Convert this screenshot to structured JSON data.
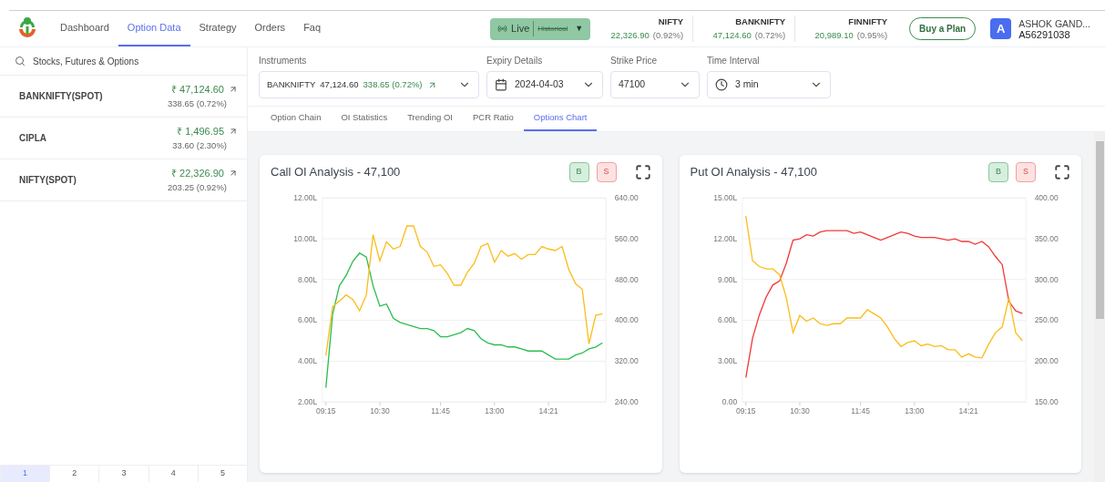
{
  "nav": {
    "items": [
      {
        "label": "Dashboard",
        "selected": false
      },
      {
        "label": "Option Data",
        "selected": true
      },
      {
        "label": "Strategy",
        "selected": false
      },
      {
        "label": "Orders",
        "selected": false
      },
      {
        "label": "Faq",
        "selected": false
      }
    ]
  },
  "mode_toggle": {
    "options": [
      {
        "label": "Live",
        "selected": true
      },
      {
        "label": "Historical",
        "selected": false
      }
    ],
    "caret": "▼"
  },
  "tickers": [
    {
      "name": "NIFTY",
      "price": "22,326.90",
      "change": "(0.92%)"
    },
    {
      "name": "BANKNIFTY",
      "price": "47,124.60",
      "change": "(0.72%)"
    },
    {
      "name": "FINNIFTY",
      "price": "20,989.10",
      "change": "(0.95%)"
    }
  ],
  "buy_button": "Buy a Plan",
  "user": {
    "initial": "A",
    "name": "ASHOK GAND...",
    "id": "A56291038"
  },
  "sidebar": {
    "search": {
      "placeholder": "Stocks, Futures & Options"
    },
    "items": [
      {
        "name": "BANKNIFTY(SPOT)",
        "price": "₹ 47,124.60",
        "change": "338.65 (0.72%)"
      },
      {
        "name": "CIPLA",
        "price": "₹ 1,496.95",
        "change": "33.60 (2.30%)"
      },
      {
        "name": "NIFTY(SPOT)",
        "price": "₹ 22,326.90",
        "change": "203.25 (0.92%)"
      }
    ],
    "pages": [
      {
        "label": "1",
        "selected": true
      },
      {
        "label": "2",
        "selected": false
      },
      {
        "label": "3",
        "selected": false
      },
      {
        "label": "4",
        "selected": false
      },
      {
        "label": "5",
        "selected": false
      }
    ]
  },
  "filters": [
    {
      "kind": "instrument",
      "label": "Instruments",
      "symbol": "BANKNIFTY",
      "price": "47,124.60",
      "change": "338.65 (0.72%)"
    },
    {
      "kind": "date",
      "label": "Expiry Details",
      "value": "2024-04-03"
    },
    {
      "kind": "plain",
      "label": "Strike Price",
      "value": "47100"
    },
    {
      "kind": "time",
      "label": "Time Interval",
      "value": "3 min"
    }
  ],
  "tabs": [
    {
      "label": "Option Chain",
      "selected": false
    },
    {
      "label": "OI Statistics",
      "selected": false
    },
    {
      "label": "Trending OI",
      "selected": false
    },
    {
      "label": "PCR Ratio",
      "selected": false
    },
    {
      "label": "Options Chart",
      "selected": true
    }
  ],
  "charts": [
    {
      "buy": "B",
      "sell": "S",
      "chart_data": {
        "type": "line",
        "title": "Call OI Analysis - 47,100",
        "grid": true,
        "categories": [
          "09:15",
          null,
          null,
          null,
          null,
          null,
          null,
          null,
          "10:30",
          null,
          null,
          null,
          null,
          null,
          null,
          null,
          null,
          "11:45",
          null,
          null,
          null,
          null,
          null,
          null,
          null,
          "13:00",
          null,
          null,
          null,
          null,
          null,
          null,
          null,
          "14:21",
          null,
          null,
          null,
          null,
          null,
          null,
          null,
          null
        ],
        "ylim": [
          2,
          12
        ],
        "yticks": [
          {
            "value": 2,
            "label": "2.00L"
          },
          {
            "value": 4,
            "label": "4.00L"
          },
          {
            "value": 6,
            "label": "6.00L"
          },
          {
            "value": 8,
            "label": "8.00L"
          },
          {
            "value": 10,
            "label": "10.00L"
          },
          {
            "value": 12,
            "label": "12.00L"
          }
        ],
        "y2lim": [
          240,
          640
        ],
        "y2ticks": [
          {
            "value": 240,
            "label": "240.00"
          },
          {
            "value": 320,
            "label": "320.00"
          },
          {
            "value": 400,
            "label": "400.00"
          },
          {
            "value": 480,
            "label": "480.00"
          },
          {
            "value": 560,
            "label": "560.00"
          },
          {
            "value": 640,
            "label": "640.00"
          }
        ],
        "series": [
          {
            "color": "#2ebd4e",
            "values": [
              2.7,
              6.3,
              7.7,
              8.2,
              8.9,
              9.3,
              9.1,
              7.7,
              6.7,
              6.8,
              6.1,
              5.9,
              5.8,
              5.7,
              5.6,
              5.6,
              5.5,
              5.2,
              5.2,
              5.3,
              5.4,
              5.6,
              5.5,
              5.1,
              4.9,
              4.8,
              4.8,
              4.7,
              4.7,
              4.6,
              4.5,
              4.5,
              4.5,
              4.3,
              4.1,
              4.1,
              4.1,
              4.3,
              4.4,
              4.6,
              4.7,
              4.9
            ]
          },
          {
            "color": "#fbbd1a",
            "axis": "y2",
            "values": [
              331,
              427,
              438,
              450,
              441,
              419,
              450,
              568,
              517,
              554,
              540,
              545,
              585,
              585,
              545,
              534,
              506,
              509,
              492,
              469,
              469,
              495,
              512,
              545,
              551,
              514,
              537,
              526,
              531,
              520,
              529,
              529,
              545,
              540,
              537,
              545,
              500,
              472,
              461,
              354,
              410,
              413
            ]
          }
        ]
      }
    },
    {
      "buy": "B",
      "sell": "S",
      "chart_data": {
        "type": "line",
        "title": "Put OI Analysis - 47,100",
        "grid": true,
        "categories": [
          "09:15",
          null,
          null,
          null,
          null,
          null,
          null,
          null,
          "10:30",
          null,
          null,
          null,
          null,
          null,
          null,
          null,
          null,
          "11:45",
          null,
          null,
          null,
          null,
          null,
          null,
          null,
          "13:00",
          null,
          null,
          null,
          null,
          null,
          null,
          null,
          "14:21",
          null,
          null,
          null,
          null,
          null,
          null,
          null,
          null
        ],
        "ylim": [
          0,
          15
        ],
        "yticks": [
          {
            "value": 0,
            "label": "0.00"
          },
          {
            "value": 3,
            "label": "3.00L"
          },
          {
            "value": 6,
            "label": "6.00L"
          },
          {
            "value": 9,
            "label": "9.00L"
          },
          {
            "value": 12,
            "label": "12.00L"
          },
          {
            "value": 15,
            "label": "15.00L"
          }
        ],
        "y2lim": [
          150,
          400
        ],
        "y2ticks": [
          {
            "value": 150,
            "label": "150.00"
          },
          {
            "value": 200,
            "label": "200.00"
          },
          {
            "value": 250,
            "label": "250.00"
          },
          {
            "value": 300,
            "label": "300.00"
          },
          {
            "value": 350,
            "label": "350.00"
          },
          {
            "value": 400,
            "label": "400.00"
          }
        ],
        "series": [
          {
            "color": "#f03a3a",
            "values": [
              1.8,
              4.7,
              6.4,
              7.7,
              8.6,
              8.9,
              10.2,
              11.9,
              12.0,
              12.3,
              12.2,
              12.5,
              12.6,
              12.6,
              12.6,
              12.6,
              12.4,
              12.5,
              12.3,
              12.1,
              11.9,
              12.1,
              12.3,
              12.5,
              12.4,
              12.2,
              12.1,
              12.1,
              12.1,
              12.0,
              11.9,
              12.0,
              11.8,
              11.8,
              11.6,
              11.8,
              11.4,
              10.7,
              10.1,
              7.4,
              6.7,
              6.5
            ]
          },
          {
            "color": "#fbbd1a",
            "axis": "y2",
            "values": [
              378,
              323,
              316,
              313,
              313,
              306,
              278,
              235,
              256,
              249,
              253,
              246,
              244,
              246,
              246,
              253,
              253,
              253,
              263,
              258,
              253,
              242,
              228,
              218,
              223,
              225,
              219,
              221,
              218,
              219,
              214,
              214,
              205,
              209,
              205,
              204,
              221,
              235,
              242,
              278,
              235,
              225
            ]
          }
        ]
      }
    }
  ]
}
